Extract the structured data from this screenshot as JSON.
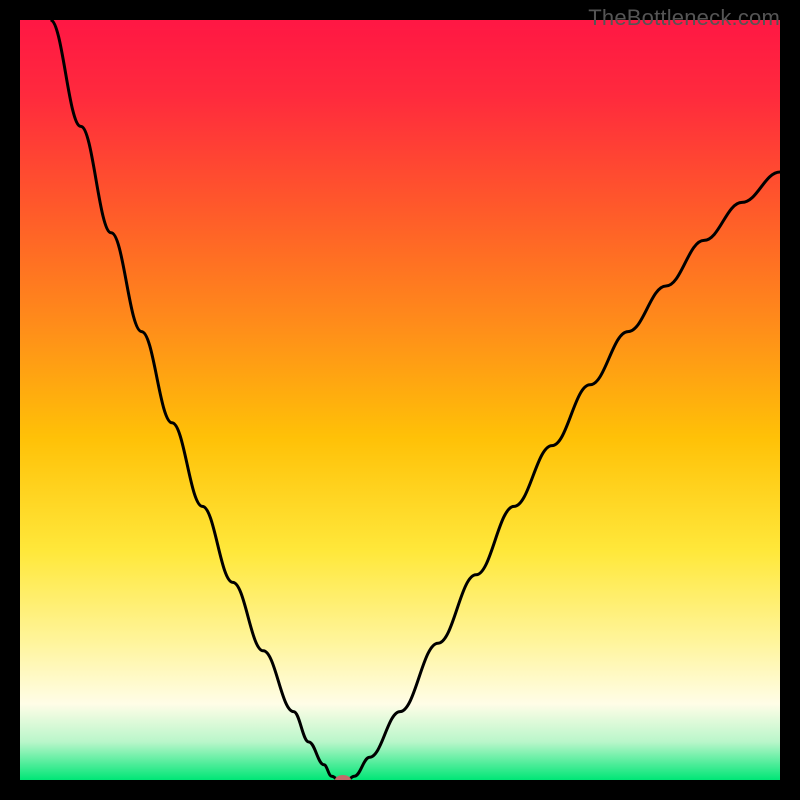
{
  "watermark": "TheBottleneck.com",
  "chart_data": {
    "type": "line",
    "title": "",
    "xlabel": "",
    "ylabel": "",
    "xlim": [
      0,
      100
    ],
    "ylim": [
      0,
      100
    ],
    "background_gradient": {
      "stops": [
        {
          "offset": 0.0,
          "color": "#ff1744"
        },
        {
          "offset": 0.1,
          "color": "#ff2a3d"
        },
        {
          "offset": 0.25,
          "color": "#ff5a2a"
        },
        {
          "offset": 0.4,
          "color": "#ff8c1a"
        },
        {
          "offset": 0.55,
          "color": "#ffc107"
        },
        {
          "offset": 0.7,
          "color": "#ffe83b"
        },
        {
          "offset": 0.82,
          "color": "#fff59d"
        },
        {
          "offset": 0.9,
          "color": "#fffde7"
        },
        {
          "offset": 0.95,
          "color": "#b9f6ca"
        },
        {
          "offset": 1.0,
          "color": "#00e676"
        }
      ]
    },
    "series": [
      {
        "name": "bottleneck-curve",
        "color": "#000000",
        "points": [
          {
            "x": 4,
            "y": 100
          },
          {
            "x": 8,
            "y": 86
          },
          {
            "x": 12,
            "y": 72
          },
          {
            "x": 16,
            "y": 59
          },
          {
            "x": 20,
            "y": 47
          },
          {
            "x": 24,
            "y": 36
          },
          {
            "x": 28,
            "y": 26
          },
          {
            "x": 32,
            "y": 17
          },
          {
            "x": 36,
            "y": 9
          },
          {
            "x": 38,
            "y": 5
          },
          {
            "x": 40,
            "y": 2
          },
          {
            "x": 41,
            "y": 0.5
          },
          {
            "x": 42,
            "y": 0
          },
          {
            "x": 43,
            "y": 0
          },
          {
            "x": 44,
            "y": 0.5
          },
          {
            "x": 46,
            "y": 3
          },
          {
            "x": 50,
            "y": 9
          },
          {
            "x": 55,
            "y": 18
          },
          {
            "x": 60,
            "y": 27
          },
          {
            "x": 65,
            "y": 36
          },
          {
            "x": 70,
            "y": 44
          },
          {
            "x": 75,
            "y": 52
          },
          {
            "x": 80,
            "y": 59
          },
          {
            "x": 85,
            "y": 65
          },
          {
            "x": 90,
            "y": 71
          },
          {
            "x": 95,
            "y": 76
          },
          {
            "x": 100,
            "y": 80
          }
        ]
      }
    ],
    "marker": {
      "x": 42.5,
      "y": 0,
      "color": "#c26a6a",
      "rx": 8,
      "ry": 5
    }
  }
}
